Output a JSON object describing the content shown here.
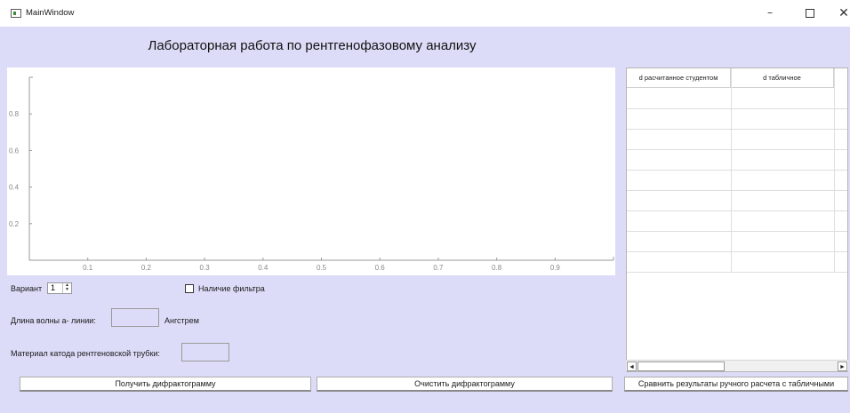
{
  "window": {
    "title": "MainWindow",
    "minimize": "–",
    "close": "✕"
  },
  "heading": "Лабораторная работа по рентгенофазовому анализу",
  "plot": {
    "chart_data": {
      "type": "line",
      "series": [],
      "xlim": [
        0,
        1
      ],
      "ylim": [
        0,
        1
      ],
      "x_ticks": [
        "0.1",
        "0.2",
        "0.3",
        "0.4",
        "0.5",
        "0.6",
        "0.7",
        "0.8",
        "0.9"
      ],
      "y_ticks": [
        "0.2",
        "0.4",
        "0.6",
        "0.8"
      ],
      "grid": false
    }
  },
  "controls": {
    "variant_label": "Вариант",
    "variant_value": "1",
    "filter_label": "Наличие фильтра",
    "filter_checked": false,
    "wavelength_label": "Длина волны а- линии:",
    "wavelength_value": "",
    "wavelength_unit": "Ангстрем",
    "cathode_label": "Материал катода рентгеновской трубки:",
    "cathode_value": ""
  },
  "buttons": {
    "get": "Получить дифрактограмму",
    "clear": "Очистить дифрактограмму",
    "compare": "Сравнить результаты ручного расчета с табличными"
  },
  "table": {
    "columns": [
      "d расчитанное студентом",
      "d табличное"
    ],
    "row_count": 9
  },
  "scrollbar": {
    "left": "◄",
    "right": "►"
  }
}
